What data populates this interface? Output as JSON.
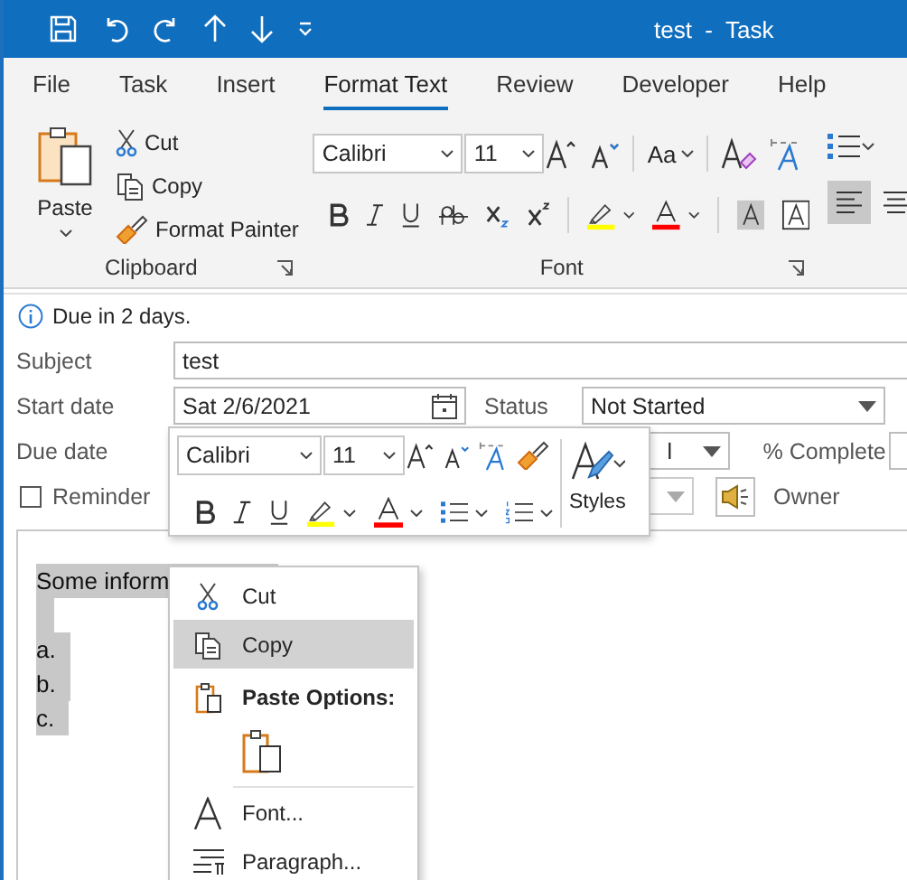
{
  "title_bar": {
    "title": "test  -  Task"
  },
  "ribbon_tabs": [
    {
      "label": "File",
      "selected": false
    },
    {
      "label": "Task",
      "selected": false
    },
    {
      "label": "Insert",
      "selected": false
    },
    {
      "label": "Format Text",
      "selected": true
    },
    {
      "label": "Review",
      "selected": false
    },
    {
      "label": "Developer",
      "selected": false
    },
    {
      "label": "Help",
      "selected": false
    }
  ],
  "ribbon": {
    "clipboard": {
      "paste": "Paste",
      "cut": "Cut",
      "copy": "Copy",
      "format_painter": "Format Painter",
      "label": "Clipboard"
    },
    "font": {
      "font_name": "Calibri",
      "font_size": "11",
      "change_case": "Aa",
      "label": "Font"
    },
    "paragraph": {
      "align_left": {
        "selected": true
      },
      "align_center": {
        "selected": false
      }
    }
  },
  "info_bar": {
    "text": "Due in 2 days."
  },
  "form": {
    "subject_label": "Subject",
    "subject_value": "test",
    "start_date_label": "Start date",
    "start_date_value": "Sat 2/6/2021",
    "status_label": "Status",
    "status_value": "Not Started",
    "due_date_label": "Due date",
    "priority_value": "l",
    "percent_complete_label": "% Complete",
    "reminder": {
      "label": "Reminder",
      "checked": false
    },
    "owner_label": "Owner"
  },
  "body": {
    "first_line": "Some inform",
    "list": [
      "a.",
      "b.",
      "c."
    ]
  },
  "mini_toolbar": {
    "font_name": "Calibri",
    "font_size": "11",
    "styles_label": "Styles"
  },
  "context_menu": {
    "items": [
      {
        "kind": "command",
        "label": "Cut",
        "selected": false
      },
      {
        "kind": "command",
        "label": "Copy",
        "selected": true
      },
      {
        "kind": "heading",
        "label": "Paste Options:"
      },
      {
        "kind": "paste-options"
      },
      {
        "kind": "separator"
      },
      {
        "kind": "command",
        "label": "Font...",
        "selected": false
      },
      {
        "kind": "command",
        "label": "Paragraph...",
        "selected": false
      }
    ]
  }
}
